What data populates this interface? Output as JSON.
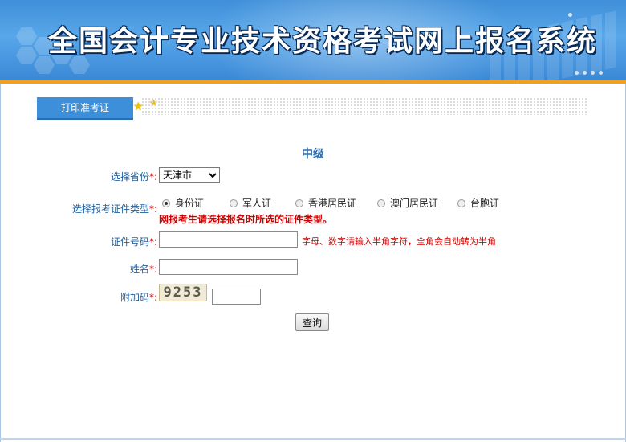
{
  "banner": {
    "title": "全国会计专业技术资格考试网上报名系统"
  },
  "tab": {
    "label": "打印准考证"
  },
  "form": {
    "level_heading": "中级",
    "province": {
      "label": "选择省份",
      "required_mark": "*:",
      "selected": "天津市"
    },
    "id_type": {
      "label": "选择报考证件类型",
      "required_mark": "*:",
      "options": [
        "身份证",
        "军人证",
        "香港居民证",
        "澳门居民证",
        "台胞证"
      ],
      "selected_index": 0,
      "warning": "网报考生请选择报名时所选的证件类型。"
    },
    "id_number": {
      "label": "证件号码",
      "required_mark": "*:",
      "value": "",
      "hint": "字母、数字请输入半角字符，全角会自动转为半角"
    },
    "name": {
      "label": "姓名",
      "required_mark": "*:",
      "value": ""
    },
    "captcha": {
      "label": "附加码",
      "required_mark": "*:",
      "image_text": "9253",
      "value": ""
    },
    "submit_label": "查询"
  },
  "colors": {
    "banner_blue": "#3f8fd9",
    "accent_orange": "#f0a020",
    "label_blue": "#1f5f9f",
    "required_red": "#d40000"
  }
}
